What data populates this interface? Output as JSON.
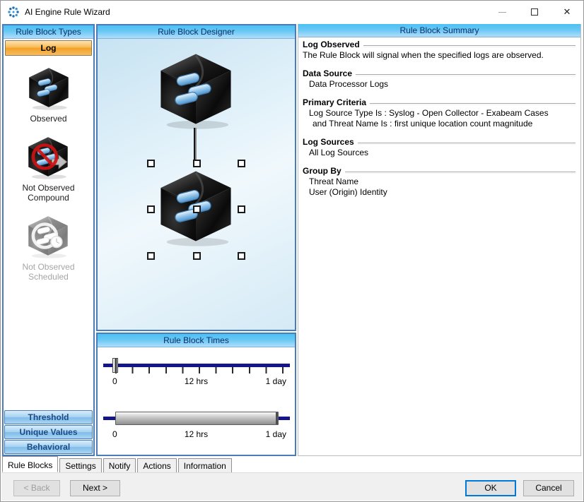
{
  "window": {
    "title": "AI Engine Rule Wizard"
  },
  "left_panel": {
    "header": "Rule Block Types",
    "log_tab": "Log",
    "items": [
      {
        "label": "Observed",
        "disabled": false
      },
      {
        "label": "Not Observed\nCompound",
        "disabled": false
      },
      {
        "label": "Not Observed\nScheduled",
        "disabled": true
      }
    ],
    "type_buttons": [
      "Threshold",
      "Unique Values",
      "Behavioral"
    ]
  },
  "designer": {
    "header": "Rule Block Designer"
  },
  "times": {
    "header": "Rule Block Times",
    "sliders": [
      {
        "labels": [
          "0",
          "12 hrs",
          "1 day"
        ]
      },
      {
        "labels": [
          "0",
          "12 hrs",
          "1 day"
        ]
      }
    ]
  },
  "summary": {
    "header": "Rule Block Summary",
    "sections": [
      {
        "title": "Log Observed",
        "lines": [
          "The Rule Block will signal when the specified logs are observed."
        ]
      },
      {
        "title": "Data Source",
        "lines": [
          "Data Processor Logs"
        ]
      },
      {
        "title": "Primary Criteria",
        "lines": [
          "Log Source Type Is : Syslog - Open Collector - Exabeam Cases",
          "and Threat Name Is : first unique location count magnitude"
        ]
      },
      {
        "title": "Log Sources",
        "lines": [
          "All Log Sources"
        ]
      },
      {
        "title": "Group By",
        "lines": [
          "Threat Name",
          "User (Origin) Identity"
        ]
      }
    ]
  },
  "tabs": [
    "Rule Blocks",
    "Settings",
    "Notify",
    "Actions",
    "Information"
  ],
  "footer": {
    "back": "< Back",
    "next": "Next >",
    "ok": "OK",
    "cancel": "Cancel"
  },
  "colors": {
    "accent_blue": "#4a7cba",
    "header_blue": "#4cc0f4",
    "log_orange": "#f2a226",
    "track_navy": "#15158a"
  }
}
